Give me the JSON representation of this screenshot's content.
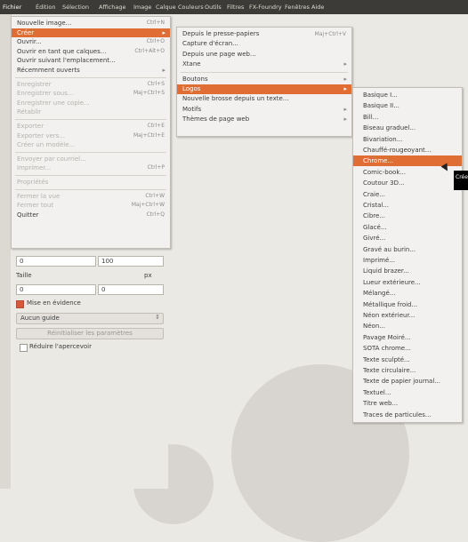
{
  "menubar": [
    "Fichier",
    "Édition",
    "Sélection",
    "Affichage",
    "Image",
    "Calque",
    "Couleurs",
    "Outils",
    "Filtres",
    "FX-Foundry",
    "Fenêtres",
    "Aide"
  ],
  "file_menu": [
    {
      "label": "Nouvelle image...",
      "shortcut": "Ctrl+N"
    },
    {
      "label": "Créer",
      "arrow": "▸",
      "highlight": true
    },
    {
      "label": "Ouvrir...",
      "shortcut": "Ctrl+O"
    },
    {
      "label": "Ouvrir en tant que calques...",
      "shortcut": "Ctrl+Alt+O"
    },
    {
      "label": "Ouvrir suivant l'emplacement...",
      "shortcut": ""
    },
    {
      "label": "Récemment ouverts",
      "arrow": "▸"
    },
    {
      "sep": true
    },
    {
      "label": "Enregistrer",
      "shortcut": "Ctrl+S",
      "disabled": true
    },
    {
      "label": "Enregistrer sous...",
      "shortcut": "Maj+Ctrl+S",
      "disabled": true
    },
    {
      "label": "Enregistrer une copie...",
      "shortcut": "",
      "disabled": true
    },
    {
      "label": "Rétablir",
      "shortcut": "",
      "disabled": true
    },
    {
      "sep": true
    },
    {
      "label": "Exporter",
      "shortcut": "Ctrl+E",
      "disabled": true
    },
    {
      "label": "Exporter vers...",
      "shortcut": "Maj+Ctrl+E",
      "disabled": true
    },
    {
      "label": "Créer un modèle...",
      "shortcut": "",
      "disabled": true
    },
    {
      "sep": true
    },
    {
      "label": "Envoyer par courriel...",
      "shortcut": "",
      "disabled": true
    },
    {
      "label": "Imprimer...",
      "shortcut": "Ctrl+P",
      "disabled": true
    },
    {
      "sep": true
    },
    {
      "label": "Propriétés",
      "shortcut": "",
      "disabled": true
    },
    {
      "sep": true
    },
    {
      "label": "Fermer la vue",
      "shortcut": "Ctrl+W",
      "disabled": true
    },
    {
      "label": "Fermer tout",
      "shortcut": "Maj+Ctrl+W",
      "disabled": true
    },
    {
      "label": "Quitter",
      "shortcut": "Ctrl+Q"
    }
  ],
  "create_menu": [
    {
      "label": "Depuis le presse-papiers",
      "shortcut": "Maj+Ctrl+V"
    },
    {
      "label": "Capture d'écran...",
      "shortcut": ""
    },
    {
      "label": "Depuis une page web...",
      "shortcut": ""
    },
    {
      "label": "Xtane",
      "arrow": "▸"
    },
    {
      "sep": true
    },
    {
      "label": "Boutons",
      "arrow": "▸"
    },
    {
      "label": "Logos",
      "arrow": "▸",
      "highlight": true
    },
    {
      "label": "Nouvelle brosse depuis un texte...",
      "shortcut": ""
    },
    {
      "label": "Motifs",
      "arrow": "▸"
    },
    {
      "label": "Thèmes de page web",
      "arrow": "▸"
    }
  ],
  "logos_menu": [
    "Basique I...",
    "Basique II...",
    "Bill...",
    "Biseau graduel...",
    "Bivariation...",
    "Chauffé-rougeoyant...",
    "Chrome...",
    "Comic-book...",
    "Coutour 3D...",
    "Craie...",
    "Cristal...",
    "Cibre...",
    "Glacé...",
    "Givré...",
    "Gravé au burin...",
    "Imprimé...",
    "Liquid brazer...",
    "Lueur extérieure...",
    "Mélangé...",
    "Métallique froid...",
    "Néon extérieur...",
    "Néon...",
    "Pavage Moiré...",
    "SOTA chrome...",
    "Texte sculpté...",
    "Texte circulaire...",
    "Texte de papier journal...",
    "Textuel...",
    "Titre web...",
    "Traces de particules..."
  ],
  "logos_highlight_index": 6,
  "tooltip": "Crée",
  "tool_options": {
    "value1": "0",
    "value2": "100",
    "section_label": "Taille",
    "unit": "px",
    "value3": "0",
    "value4": "0",
    "check1_label": "Mise en évidence",
    "dropdown_value": "Aucun guide",
    "button_label": "Réinitialiser les paramètres",
    "check2_label": "Réduire l'apercevoir"
  }
}
